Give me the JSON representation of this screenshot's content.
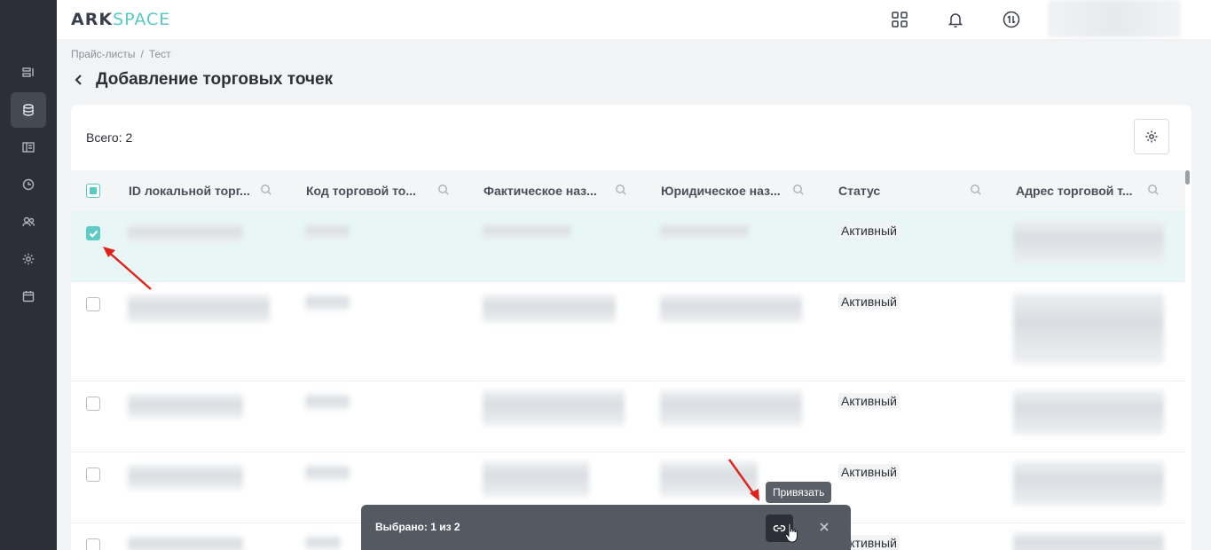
{
  "app": {
    "logo_ark": "ARK",
    "logo_space": "SPACE"
  },
  "sidebar": {
    "items": [
      {
        "icon": "layout-list-icon",
        "active": false
      },
      {
        "icon": "database-icon",
        "active": true
      },
      {
        "icon": "panel-icon",
        "active": false
      },
      {
        "icon": "clock-icon",
        "active": false
      },
      {
        "icon": "users-icon",
        "active": false
      },
      {
        "icon": "gear-icon",
        "active": false
      },
      {
        "icon": "calendar-icon",
        "active": false
      }
    ]
  },
  "topbar": {
    "icons": [
      "apps-grid-icon",
      "bell-icon",
      "exchange-icon"
    ]
  },
  "breadcrumb": {
    "items": [
      "Прайс-листы",
      "Тест"
    ],
    "separator": "/"
  },
  "page": {
    "title": "Добавление торговых точек"
  },
  "table": {
    "total_label": "Всего: 2",
    "columns": [
      "ID локальной торг...",
      "Код торговой то...",
      "Фактическое наз...",
      "Юридическое наз...",
      "Статус",
      "Адрес торговой т..."
    ],
    "rows": [
      {
        "checked": true,
        "status": "Активный"
      },
      {
        "checked": false,
        "status": "Активный"
      },
      {
        "checked": false,
        "status": "Активный"
      },
      {
        "checked": false,
        "status": "Активный"
      },
      {
        "checked": false,
        "status": "Активный"
      }
    ]
  },
  "bulk_actions": {
    "selected_text": "Выбрано: 1 из 2",
    "tooltip": "Привязать"
  },
  "colors": {
    "accent": "#59c9c6",
    "sidebar_bg": "#2c2f37",
    "annotation_arrow": "#e0221b"
  }
}
